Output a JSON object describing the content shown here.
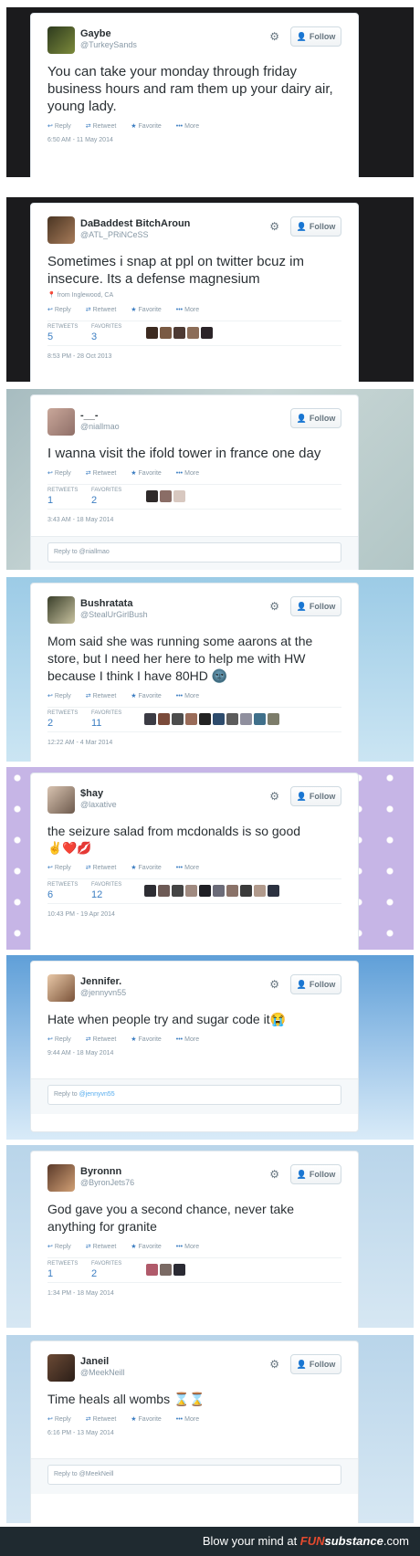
{
  "common": {
    "follow_label": "Follow",
    "reply_label": "Reply",
    "retweet_label": "Retweet",
    "favorite_label": "Favorite",
    "more_label": "More",
    "retweets_label": "RETWEETS",
    "favorites_label": "FAVORITES",
    "reply_prefix": "Reply to "
  },
  "tweets": [
    {
      "name": "Gaybe",
      "handle": "@TurkeySands",
      "text": "You can take your monday through friday business hours and ram them up your dairy air, young lady.",
      "time": "6:50 AM - 11 May 2014"
    },
    {
      "name": "DaBaddest BitchAroun",
      "handle": "@ATL_PRiNCeSS",
      "text": "Sometimes i snap at ppl on twitter bcuz im insecure. Its a defense magnesium",
      "location": "from Inglewood, CA",
      "retweets": "5",
      "favorites": "3",
      "time": "8:53 PM - 28 Oct 2013"
    },
    {
      "name": "-__-",
      "handle": "@niallmao",
      "text": "I wanna visit the ifold tower in france one day",
      "retweets": "1",
      "favorites": "2",
      "time": "3:43 AM - 18 May 2014",
      "reply_to": "@niallmao"
    },
    {
      "name": "Bushratata",
      "handle": "@StealUrGirlBush",
      "text": "Mom said she was running some aarons at the store, but I need her here to help me with HW because I think I have 80HD 🌚",
      "retweets": "2",
      "favorites": "11",
      "time": "12:22 AM - 4 Mar 2014"
    },
    {
      "name": "$hay",
      "handle": "@laxative",
      "text": "the seizure salad from mcdonalds is so good",
      "emoji": "✌️❤️💋",
      "retweets": "6",
      "favorites": "12",
      "time": "10:43 PM - 19 Apr 2014"
    },
    {
      "name": "Jennifer.",
      "handle": "@jennyvn55",
      "text": "Hate when people try and sugar code it😭",
      "time": "9:44 AM - 18 May 2014",
      "reply_to": "@jennyvn55"
    },
    {
      "name": "Byronnn",
      "handle": "@ByronJets76",
      "text": "God gave you a second chance, never take anything for granite",
      "retweets": "1",
      "favorites": "2",
      "time": "1:34 PM - 18 May 2014"
    },
    {
      "name": "Janeil",
      "handle": "@MeekNeill",
      "text": "Time heals all wombs ⌛⌛",
      "time": "6:16 PM - 13 May 2014",
      "reply_to": "@MeekNeill"
    }
  ],
  "footer": {
    "text": "Blow your mind at ",
    "brand_a": "FUN",
    "brand_b": "substance",
    "brand_c": ".com"
  },
  "colors": {
    "link_blue": "#55acee",
    "action_blue": "#3c7ec2",
    "muted_gray": "#8899a6",
    "footer_bg": "#1f2a30"
  },
  "icons": [
    "gear-icon",
    "follow-person-icon",
    "reply-icon",
    "retweet-icon",
    "favorite-star-icon",
    "more-dots-icon",
    "location-pin-icon"
  ]
}
